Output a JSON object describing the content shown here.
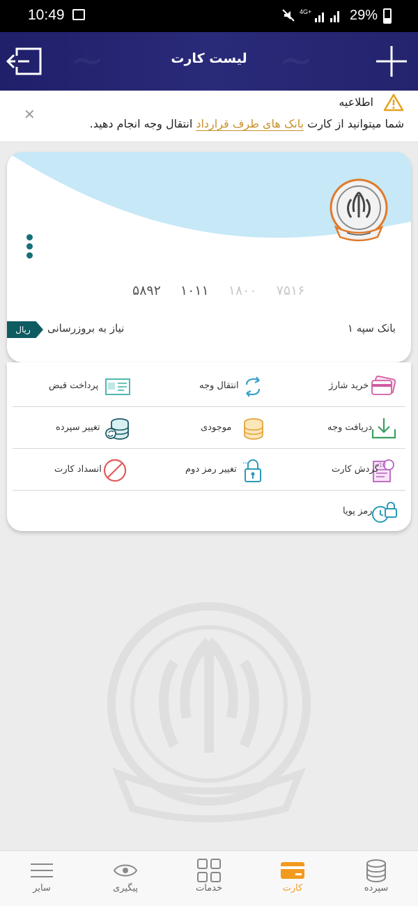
{
  "status_bar": {
    "time": "10:49",
    "network": "4G+",
    "battery": "29%"
  },
  "header": {
    "title": "لیست کارت"
  },
  "notice": {
    "title": "اطلاعیه",
    "text_before": "شما میتوانید از کارت",
    "link": "بانک های طرف قرارداد",
    "text_after": "انتقال وجه انجام دهید."
  },
  "card": {
    "number_groups": [
      "۵۸۹۲",
      "۱۰۱۱",
      "۱۸۰۰",
      "۷۵۱۶"
    ],
    "currency_badge": "ریال",
    "update_status": "نیاز به بروزرسانی",
    "bank_name": "بانک سپه ۱"
  },
  "services": [
    [
      "خرید شارژ",
      "انتقال وجه",
      "پرداخت قبض"
    ],
    [
      "دریافت وجه",
      "موجودی",
      "تغییر سپرده"
    ],
    [
      "گردش کارت",
      "تغییر رمز دوم",
      "انسداد کارت"
    ],
    [
      "رمز پویا"
    ]
  ],
  "nav": {
    "items": [
      "سپرده",
      "کارت",
      "خدمات",
      "پیگیری",
      "سایر"
    ],
    "active": "کارت"
  },
  "colors": {
    "header_bg": "#26266f",
    "accent_teal": "#176f78",
    "accent_orange": "#f29a1f",
    "link_gold": "#c8902a"
  }
}
